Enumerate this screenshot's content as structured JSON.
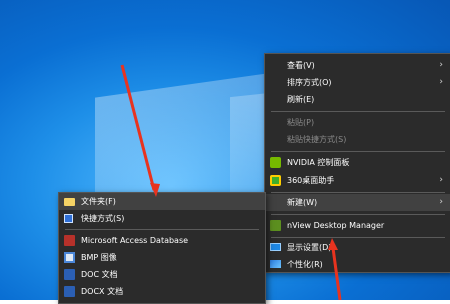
{
  "context_menu": {
    "items": [
      {
        "label": "查看(V)",
        "submenu": true
      },
      {
        "label": "排序方式(O)",
        "submenu": true
      },
      {
        "label": "刷新(E)"
      },
      {
        "label": "粘贴(P)",
        "disabled": true
      },
      {
        "label": "粘贴快捷方式(S)",
        "disabled": true
      },
      {
        "label": "NVIDIA 控制面板",
        "icon": "nvidia-icon"
      },
      {
        "label": "360桌面助手",
        "icon": "360-icon",
        "submenu": true
      },
      {
        "label": "新建(W)",
        "submenu": true,
        "highlighted": true
      },
      {
        "label": "nView Desktop Manager",
        "icon": "nview-icon"
      },
      {
        "label": "显示设置(D)",
        "icon": "display-icon"
      },
      {
        "label": "个性化(R)",
        "icon": "personalize-icon"
      }
    ]
  },
  "new_submenu": {
    "items": [
      {
        "label": "文件夹(F)",
        "icon": "folder-icon"
      },
      {
        "label": "快捷方式(S)",
        "icon": "shortcut-icon"
      },
      {
        "label": "Microsoft Access Database",
        "icon": "access-icon"
      },
      {
        "label": "BMP 图像",
        "icon": "bmp-icon"
      },
      {
        "label": "DOC 文档",
        "icon": "doc-icon"
      },
      {
        "label": "DOCX 文档",
        "icon": "docx-icon"
      }
    ]
  },
  "colors": {
    "menu_bg": "#2b2b2b",
    "highlight": "#414141",
    "arrow": "#e8331f",
    "desktop": "#0a6fd3"
  }
}
